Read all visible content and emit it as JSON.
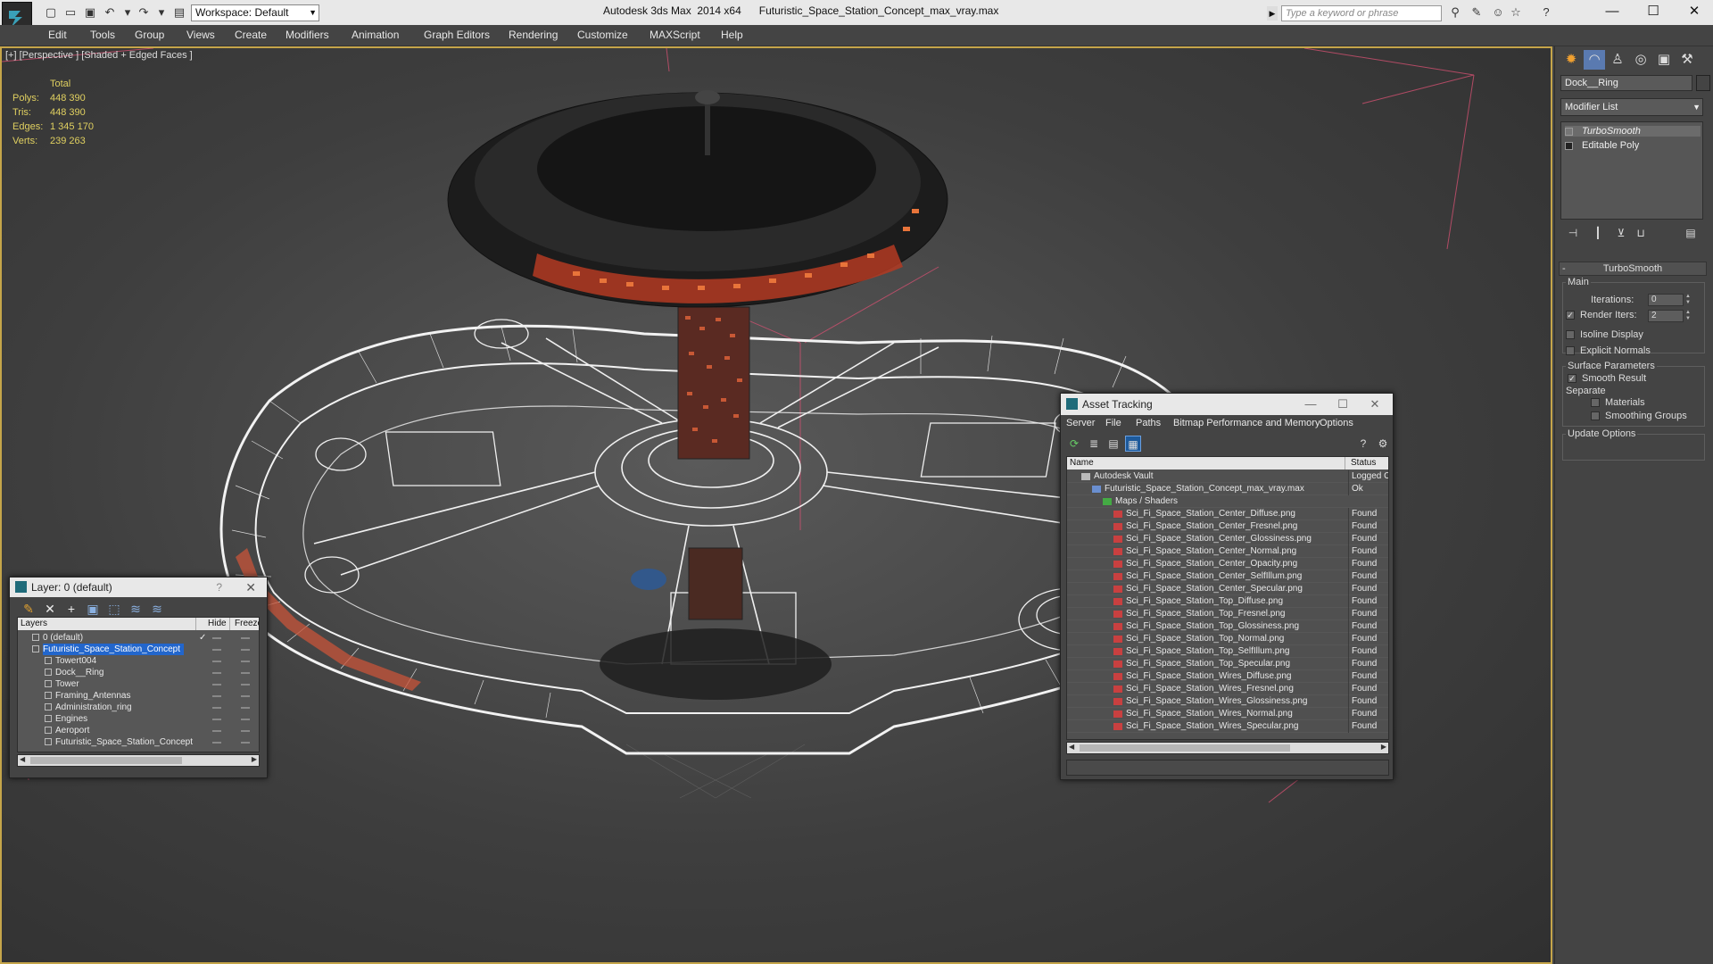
{
  "titlebar": {
    "workspace": "Workspace: Default",
    "app_title": "Autodesk 3ds Max  2014 x64",
    "file_title": "Futuristic_Space_Station_Concept_max_vray.max",
    "search_placeholder": "Type a keyword or phrase",
    "icons": [
      "new-file-icon",
      "open-folder-icon",
      "save-icon",
      "undo-icon",
      "redo-icon",
      "project-folder-icon"
    ],
    "help_icons": [
      "binoculars-icon",
      "search-tools-icon",
      "star-icon",
      "help-icon"
    ]
  },
  "menu": [
    "Edit",
    "Tools",
    "Group",
    "Views",
    "Create",
    "Modifiers",
    "Animation",
    "Graph Editors",
    "Rendering",
    "Customize",
    "MAXScript",
    "Help"
  ],
  "viewport": {
    "label": "[+] [Perspective ] [Shaded + Edged Faces ]",
    "stats": {
      "header": "Total",
      "rows": [
        {
          "label": "Polys:",
          "value": "448 390"
        },
        {
          "label": "Tris:",
          "value": "448 390"
        },
        {
          "label": "Edges:",
          "value": "1 345 170"
        },
        {
          "label": "Verts:",
          "value": "239 263"
        }
      ]
    },
    "accent_color": "#c5a54a"
  },
  "command_panel": {
    "tabs": [
      "create-icon",
      "modify-icon",
      "hierarchy-icon",
      "motion-icon",
      "display-icon",
      "utilities-icon"
    ],
    "object_name": "Dock__Ring",
    "modifier_list": "Modifier List",
    "stack": [
      "TurboSmooth",
      "Editable Poly"
    ],
    "rollout_title": "TurboSmooth",
    "main_group": "Main",
    "iterations_label": "Iterations:",
    "iterations_value": "0",
    "render_iters_label": "Render Iters:",
    "render_iters_value": "2",
    "isoline_label": "Isoline Display",
    "explicit_normals_label": "Explicit Normals",
    "surface_group": "Surface Parameters",
    "smooth_result_label": "Smooth Result",
    "separate_label": "Separate",
    "materials_label": "Materials",
    "smoothing_groups_label": "Smoothing Groups",
    "update_group": "Update Options"
  },
  "layer_explorer": {
    "title": "Layer: 0 (default)",
    "help": "?",
    "columns": [
      "Layers",
      "Hide",
      "Freeze"
    ],
    "rows": [
      {
        "name": "0 (default)",
        "level": 0,
        "checked": true,
        "selected": false
      },
      {
        "name": "Futuristic_Space_Station_Concept",
        "level": 0,
        "checked": false,
        "selected": true
      },
      {
        "name": "Towert004",
        "level": 1,
        "checked": false,
        "selected": false
      },
      {
        "name": "Dock__Ring",
        "level": 1,
        "checked": false,
        "selected": false
      },
      {
        "name": "Tower",
        "level": 1,
        "checked": false,
        "selected": false
      },
      {
        "name": "Framing_Antennas",
        "level": 1,
        "checked": false,
        "selected": false
      },
      {
        "name": "Administration_ring",
        "level": 1,
        "checked": false,
        "selected": false
      },
      {
        "name": "Engines",
        "level": 1,
        "checked": false,
        "selected": false
      },
      {
        "name": "Aeroport",
        "level": 1,
        "checked": false,
        "selected": false
      },
      {
        "name": "Futuristic_Space_Station_Concept",
        "level": 1,
        "checked": false,
        "selected": false
      }
    ]
  },
  "asset_tracking": {
    "title": "Asset Tracking",
    "menu": [
      "Server",
      "File",
      "Paths",
      "Bitmap Performance and Memory",
      "Options"
    ],
    "columns": [
      "Name",
      "Status"
    ],
    "rows": [
      {
        "name": "Autodesk Vault",
        "status": "Logged Ou",
        "level": 0
      },
      {
        "name": "Futuristic_Space_Station_Concept_max_vray.max",
        "status": "Ok",
        "level": 1
      },
      {
        "name": "Maps / Shaders",
        "status": "",
        "level": 2
      },
      {
        "name": "Sci_Fi_Space_Station_Center_Diffuse.png",
        "status": "Found",
        "level": 3
      },
      {
        "name": "Sci_Fi_Space_Station_Center_Fresnel.png",
        "status": "Found",
        "level": 3
      },
      {
        "name": "Sci_Fi_Space_Station_Center_Glossiness.png",
        "status": "Found",
        "level": 3
      },
      {
        "name": "Sci_Fi_Space_Station_Center_Normal.png",
        "status": "Found",
        "level": 3
      },
      {
        "name": "Sci_Fi_Space_Station_Center_Opacity.png",
        "status": "Found",
        "level": 3
      },
      {
        "name": "Sci_Fi_Space_Station_Center_SelfIllum.png",
        "status": "Found",
        "level": 3
      },
      {
        "name": "Sci_Fi_Space_Station_Center_Specular.png",
        "status": "Found",
        "level": 3
      },
      {
        "name": "Sci_Fi_Space_Station_Top_Diffuse.png",
        "status": "Found",
        "level": 3
      },
      {
        "name": "Sci_Fi_Space_Station_Top_Fresnel.png",
        "status": "Found",
        "level": 3
      },
      {
        "name": "Sci_Fi_Space_Station_Top_Glossiness.png",
        "status": "Found",
        "level": 3
      },
      {
        "name": "Sci_Fi_Space_Station_Top_Normal.png",
        "status": "Found",
        "level": 3
      },
      {
        "name": "Sci_Fi_Space_Station_Top_SelfIllum.png",
        "status": "Found",
        "level": 3
      },
      {
        "name": "Sci_Fi_Space_Station_Top_Specular.png",
        "status": "Found",
        "level": 3
      },
      {
        "name": "Sci_Fi_Space_Station_Wires_Diffuse.png",
        "status": "Found",
        "level": 3
      },
      {
        "name": "Sci_Fi_Space_Station_Wires_Fresnel.png",
        "status": "Found",
        "level": 3
      },
      {
        "name": "Sci_Fi_Space_Station_Wires_Glossiness.png",
        "status": "Found",
        "level": 3
      },
      {
        "name": "Sci_Fi_Space_Station_Wires_Normal.png",
        "status": "Found",
        "level": 3
      },
      {
        "name": "Sci_Fi_Space_Station_Wires_Specular.png",
        "status": "Found",
        "level": 3
      }
    ]
  }
}
